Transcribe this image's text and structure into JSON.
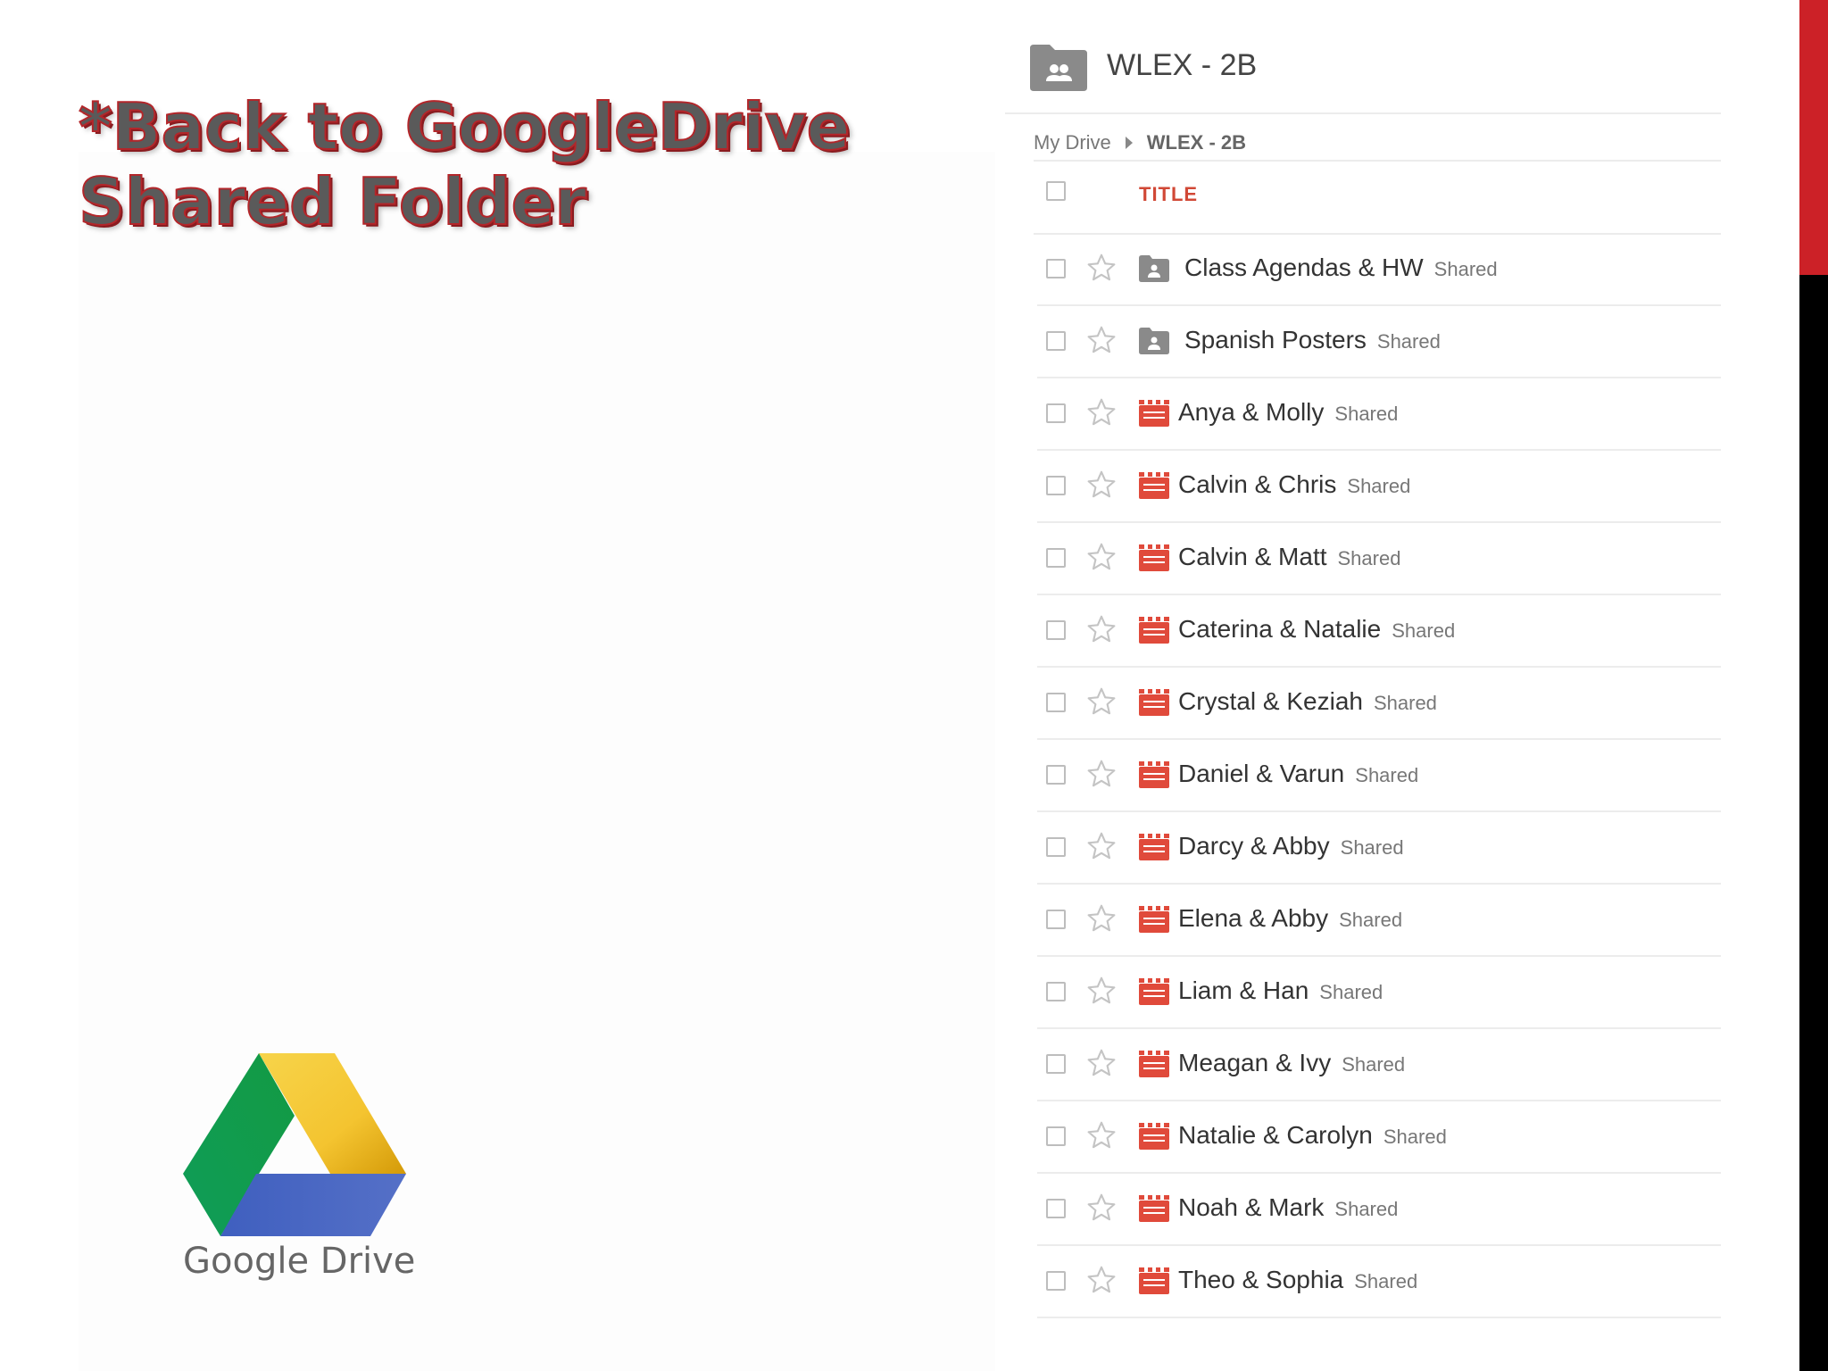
{
  "slide": {
    "title_line1": "*Back to GoogleDrive",
    "title_line2": "Shared Folder",
    "logo_text": "Google Drive"
  },
  "drive": {
    "folder_title": "WLEX - 2B",
    "breadcrumb": {
      "root": "My Drive",
      "current": "WLEX - 2B"
    },
    "column_title": "TITLE",
    "items": [
      {
        "name": "Class Agendas & HW",
        "badge": "Shared",
        "type": "shared-folder"
      },
      {
        "name": "Spanish Posters",
        "badge": "Shared",
        "type": "shared-folder"
      },
      {
        "name": "Anya & Molly",
        "badge": "Shared",
        "type": "video"
      },
      {
        "name": "Calvin & Chris",
        "badge": "Shared",
        "type": "video"
      },
      {
        "name": "Calvin & Matt",
        "badge": "Shared",
        "type": "video"
      },
      {
        "name": "Caterina & Natalie",
        "badge": "Shared",
        "type": "video"
      },
      {
        "name": "Crystal & Keziah",
        "badge": "Shared",
        "type": "video"
      },
      {
        "name": "Daniel & Varun",
        "badge": "Shared",
        "type": "video"
      },
      {
        "name": "Darcy & Abby",
        "badge": "Shared",
        "type": "video"
      },
      {
        "name": "Elena & Abby",
        "badge": "Shared",
        "type": "video"
      },
      {
        "name": "Liam & Han",
        "badge": "Shared",
        "type": "video"
      },
      {
        "name": "Meagan & Ivy",
        "badge": "Shared",
        "type": "video"
      },
      {
        "name": "Natalie & Carolyn",
        "badge": "Shared",
        "type": "video"
      },
      {
        "name": "Noah & Mark",
        "badge": "Shared",
        "type": "video"
      },
      {
        "name": "Theo & Sophia",
        "badge": "Shared",
        "type": "video"
      }
    ]
  },
  "colors": {
    "accent_red": "#cc2127",
    "video_icon": "#e04a3b",
    "folder_icon": "#8a8a8a",
    "column_title": "#d14836"
  },
  "icons": {
    "header_folder": "shared-folder-icon",
    "star": "star-icon",
    "video": "video-icon",
    "folder": "shared-folder-icon"
  }
}
